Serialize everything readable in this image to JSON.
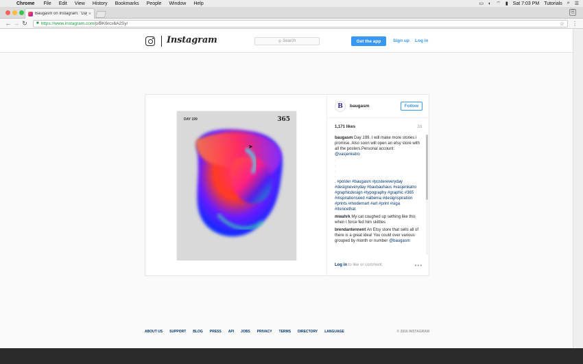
{
  "menubar": {
    "app": "Chrome",
    "items": [
      "File",
      "Edit",
      "View",
      "History",
      "Bookmarks",
      "People",
      "Window",
      "Help"
    ],
    "clock": "Sat 7:03 PM",
    "user": "Tutorials",
    "tray_icons": [
      "airplay-icon",
      "wifi-icon",
      "battery-icon",
      "search-icon",
      "list-icon"
    ]
  },
  "browser": {
    "tab_title": "Baugasm on Instagram: \"Day",
    "url_scheme_host": "https://www.instagram.com",
    "url_path": "/p/BK6rcs6A2Sy/"
  },
  "header": {
    "wordmark": "Instagram",
    "search_placeholder": "Search",
    "get_app": "Get the app",
    "sign_up": "Sign up",
    "log_in": "Log in"
  },
  "post": {
    "poster": {
      "day_label": "DAY 199",
      "number": "365"
    },
    "avatar_letter": "B",
    "username": "baugasm",
    "follow": "Follow",
    "likes": "1,171 likes",
    "age": "2d",
    "caption": {
      "author": "baugasm",
      "text": "Day 199. I will make more stories i promise. Also soon will open an etsy store with all the posters.Personal account:",
      "mention": "@vasjenkatro",
      "dots": [
        ".",
        ".",
        ".",
        "."
      ],
      "hashtags": ". #poster #baugasm #posterevery­day #designeveryday #baubauhaus #vasjenkatro #graphicdesign #typography #graphic #365 #inspirationseed #albenia #designspiration #prints #modernart #art #print #siga #itsnicethat"
    },
    "comments": [
      {
        "author": "mwahrk",
        "text": "My cat coughed up sething like this when I force fed him skittles"
      },
      {
        "author": "brendantennent",
        "text": "An Etsy store that sells all of there is a great idea! You could over various grouped by month or number",
        "mention": "@baugasm"
      }
    ],
    "footer_login": "Log in",
    "footer_rest": "to like or comment."
  },
  "footer": {
    "links": [
      "ABOUT US",
      "SUPPORT",
      "BLOG",
      "PRESS",
      "API",
      "JOBS",
      "PRIVACY",
      "TERMS",
      "DIRECTORY",
      "LANGUAGE"
    ],
    "copyright": "© 2016 INSTAGRAM"
  }
}
